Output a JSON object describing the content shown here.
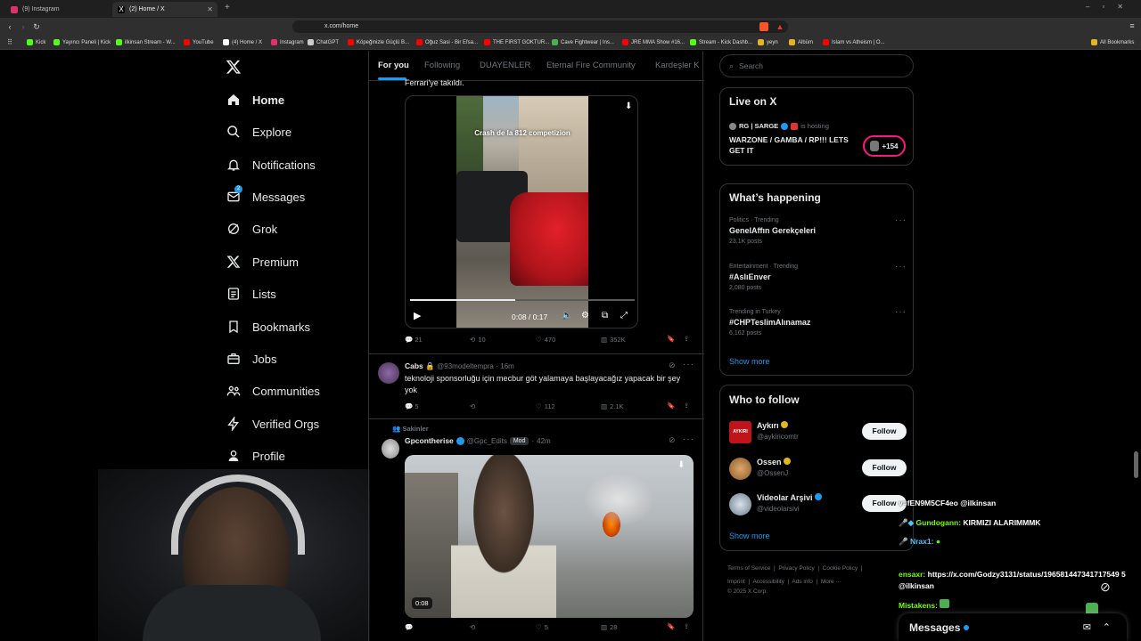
{
  "browser": {
    "tabs": [
      {
        "label": "(9) Instagram",
        "color": "#e1306c"
      },
      {
        "label": "(2) Home / X",
        "color": "#ffffff"
      }
    ],
    "url": "x.com/home",
    "bookmarks": [
      {
        "label": "Kick",
        "color": "#53fc18"
      },
      {
        "label": "Yayıncı Paneli | Kick",
        "color": "#53fc18"
      },
      {
        "label": "ilkinsan Stream - W...",
        "color": "#53fc18"
      },
      {
        "label": "YouTube",
        "color": "#ff0000"
      },
      {
        "label": "(4) Home / X",
        "color": "#ffffff"
      },
      {
        "label": "Instagram",
        "color": "#e1306c"
      },
      {
        "label": "ChatGPT",
        "color": "#cccccc"
      },
      {
        "label": "Köpeğinizle Güçlü B...",
        "color": "#ff0000"
      },
      {
        "label": "Oğuz Sasi - Bir Efsa...",
        "color": "#ff0000"
      },
      {
        "label": "THE FIRST GOKTUR...",
        "color": "#ff0000"
      },
      {
        "label": "Cave Fightwear | Ins...",
        "color": "#4caf50"
      },
      {
        "label": "JRE MMA Show #16...",
        "color": "#ff0000"
      },
      {
        "label": "Stream - Kick Dashb...",
        "color": "#53fc18"
      },
      {
        "label": "yeyn",
        "color": "#e6b422"
      },
      {
        "label": "Albüm",
        "color": "#e6b422"
      },
      {
        "label": "Islam vs Atheism | O...",
        "color": "#ff0000"
      }
    ],
    "all_bookmarks": "All Bookmarks"
  },
  "sidebar": {
    "logo": "x-logo-icon",
    "items": [
      {
        "label": "Home",
        "icon": "home-icon"
      },
      {
        "label": "Explore",
        "icon": "search-icon"
      },
      {
        "label": "Notifications",
        "icon": "bell-icon"
      },
      {
        "label": "Messages",
        "icon": "mail-icon",
        "badge": "2"
      },
      {
        "label": "Grok",
        "icon": "grok-icon"
      },
      {
        "label": "Premium",
        "icon": "x-icon"
      },
      {
        "label": "Lists",
        "icon": "list-icon"
      },
      {
        "label": "Bookmarks",
        "icon": "bookmark-icon"
      },
      {
        "label": "Jobs",
        "icon": "briefcase-icon"
      },
      {
        "label": "Communities",
        "icon": "people-icon"
      },
      {
        "label": "Verified Orgs",
        "icon": "lightning-icon"
      },
      {
        "label": "Profile",
        "icon": "person-icon"
      }
    ]
  },
  "feed": {
    "tabs": [
      "For you",
      "Following",
      "DUAYENLER",
      "Eternal Fire Community",
      "Kardeşler K"
    ],
    "post1": {
      "text_tail": "Ferrari'ye takıldı.",
      "video_caption": "Crash de la 812 competizion",
      "time": "0:08 / 0:17",
      "replies": "21",
      "reposts": "10",
      "likes": "470",
      "views": "352K"
    },
    "post2": {
      "name": "Cabs",
      "handle": "@93modeltempra",
      "time": "16m",
      "text": "teknoloji sponsorluğu için mecbur göt yalamaya başlayacağız yapacak bir şey yok",
      "replies": "5",
      "reposts": "",
      "likes": "112",
      "views": "2.1K"
    },
    "post3": {
      "context": "Sakinler",
      "name": "Gpcontherise",
      "handle": "@Gpc_Edits",
      "badge": "Mod",
      "time": "42m",
      "video_time": "0:08",
      "replies": "",
      "reposts": "",
      "likes": "5",
      "views": "28"
    }
  },
  "right": {
    "search_placeholder": "Search",
    "live": {
      "title": "Live on X",
      "host": "RG | SARGE",
      "hosting": "is hosting",
      "stream_title": "WARZONE / GAMBA / RP!!! LETS GET IT",
      "count": "+154"
    },
    "happening": {
      "title": "What’s happening",
      "trends": [
        {
          "category": "Politics · Trending",
          "name": "GenelAffın Gerekçeleri",
          "posts": "23.1K posts"
        },
        {
          "category": "Entertainment · Trending",
          "name": "#AslıEnver",
          "posts": "2,080 posts"
        },
        {
          "category": "Trending in Turkey",
          "name": "#CHPTeslimAlınamaz",
          "posts": "6,162 posts"
        }
      ],
      "show_more": "Show more"
    },
    "who_to_follow": {
      "title": "Who to follow",
      "accounts": [
        {
          "name": "Aykırı",
          "handle": "@aykiricomtr",
          "avatar_text": "AYKIRI"
        },
        {
          "name": "Ossen",
          "handle": "@OssenJ",
          "avatar_text": ""
        },
        {
          "name": "Videolar Arşivi",
          "handle": "@videolarsivi",
          "avatar_text": ""
        }
      ],
      "follow_label": "Follow",
      "show_more": "Show more"
    },
    "footer": {
      "links": [
        "Terms of Service",
        "Privacy Policy",
        "Cookie Policy",
        "Imprint",
        "Accessibility",
        "Ads info",
        "More ···"
      ],
      "copyright": "© 2025 X Corp."
    }
  },
  "chat_overlay": [
    {
      "user": "",
      "text": "v=fEN9M5CF4eo @ilkinsan"
    },
    {
      "user": "Gundogann:",
      "text": "KIRMIZI ALARIMMMK"
    },
    {
      "user": "Nrax1:",
      "text": ""
    },
    {
      "user": "ensaxr:",
      "text": "https://x.com/Godzy3131/status/196581447341717549 5 @ilkinsan"
    },
    {
      "user": "Mistakens:",
      "text": ""
    }
  ],
  "messages_drawer": {
    "label": "Messages"
  },
  "colors": {
    "accent": "#1d9bf0",
    "verified": "#1d9bf0",
    "gold": "#e2b719"
  }
}
